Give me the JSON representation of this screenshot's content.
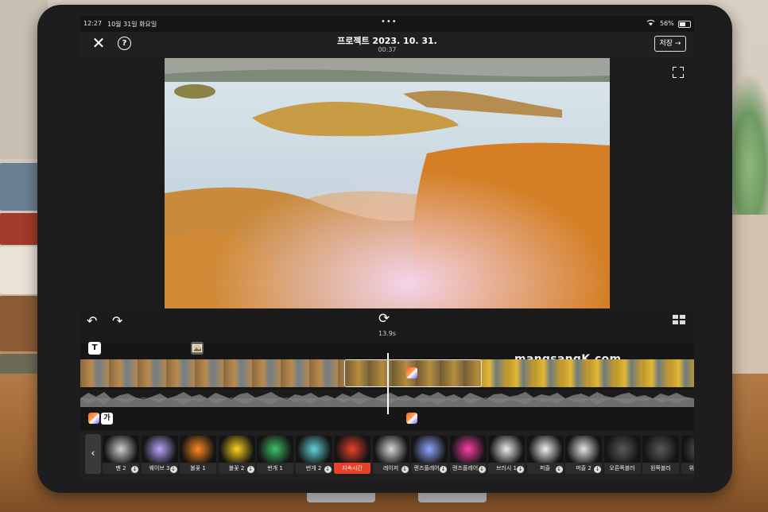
{
  "status_bar": {
    "time": "12:27",
    "date": "10월 31일 화요일",
    "battery": "56%"
  },
  "header": {
    "title": "프로젝트 2023. 10. 31.",
    "duration": "00:37",
    "save_label": "저장 →",
    "close_glyph": "✕",
    "help_glyph": "?"
  },
  "timeline": {
    "clip_length": "13.9s",
    "text_marker": "T",
    "text_layer": "가"
  },
  "watermark": "mangsangK.com",
  "effects": {
    "back_glyph": "‹",
    "items": [
      {
        "label": "팬 2",
        "download": true,
        "art": "#cfcfcf"
      },
      {
        "label": "웨이브 3",
        "download": true,
        "art": "#b9a5ff"
      },
      {
        "label": "불꽃 1",
        "download": false,
        "art": "#ff8a1f"
      },
      {
        "label": "불꽃 2",
        "download": true,
        "art": "#ffd21f"
      },
      {
        "label": "번개 1",
        "download": false,
        "art": "#3fbf6a"
      },
      {
        "label": "번개 2",
        "download": true,
        "art": "#62d3d8"
      },
      {
        "label": "지속시간",
        "download": false,
        "art": "#e8412b"
      },
      {
        "label": "레이저",
        "download": true,
        "art": "#d9d9d9"
      },
      {
        "label": "렌즈플레어 1",
        "download": true,
        "art": "#8fa7ff"
      },
      {
        "label": "렌즈플레어 2",
        "download": true,
        "art": "#ff3fa8"
      },
      {
        "label": "브러시 1",
        "download": true,
        "art": "#eeeeee"
      },
      {
        "label": "퍼즐",
        "download": true,
        "art": "#f0f0f0"
      },
      {
        "label": "퍼즐 2",
        "download": true,
        "art": "#e6e6e6"
      },
      {
        "label": "오른쪽블러",
        "download": false,
        "art": "#5a5a5a"
      },
      {
        "label": "왼쪽블러",
        "download": false,
        "art": "#5a5a5a"
      },
      {
        "label": "위로블러",
        "download": false,
        "art": "#5a5a5a"
      }
    ]
  }
}
